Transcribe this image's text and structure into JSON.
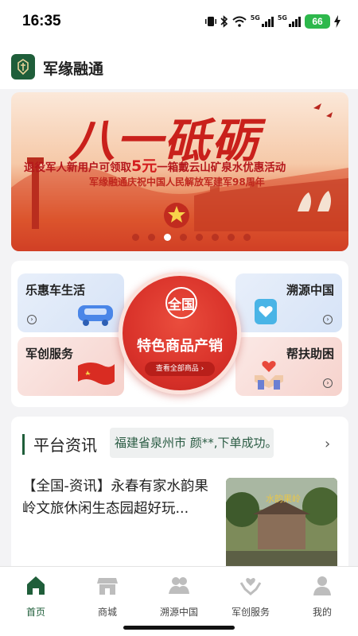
{
  "status_bar": {
    "time": "16:35",
    "battery": "66"
  },
  "app": {
    "title": "军缘融通"
  },
  "banner": {
    "title": "八一砥砺",
    "subtitle_parts": [
      "退役军人新用户可领取",
      "5元",
      "一箱戴云山矿泉水优惠活动"
    ],
    "subtitle2": "军缘融通庆祝中国人民解放军建军98周年",
    "dots_count": 8,
    "active_dot": 2
  },
  "services": {
    "car": {
      "label": "乐惠车生活"
    },
    "origin": {
      "label": "溯源中国"
    },
    "army": {
      "label": "军创服务"
    },
    "help": {
      "label": "帮扶助困"
    },
    "center": {
      "badge": "全国",
      "title": "特色商品产销",
      "link": "查看全部商品 ›"
    }
  },
  "news": {
    "title": "平台资讯",
    "ticker": "福建省泉州市 颜**,下单成功。",
    "article": {
      "text": "【全国-资讯】永春有家水韵果岭文旅休闲生态园超好玩..."
    }
  },
  "tabs": [
    {
      "label": "首页",
      "icon": "home-icon",
      "active": true
    },
    {
      "label": "商城",
      "icon": "store-icon",
      "active": false
    },
    {
      "label": "溯源中国",
      "icon": "users-icon",
      "active": false
    },
    {
      "label": "军创服务",
      "icon": "hands-heart-icon",
      "active": false
    },
    {
      "label": "我的",
      "icon": "person-icon",
      "active": false
    }
  ],
  "colors": {
    "brand": "#1f5e3a",
    "accent_red": "#d9322a"
  }
}
